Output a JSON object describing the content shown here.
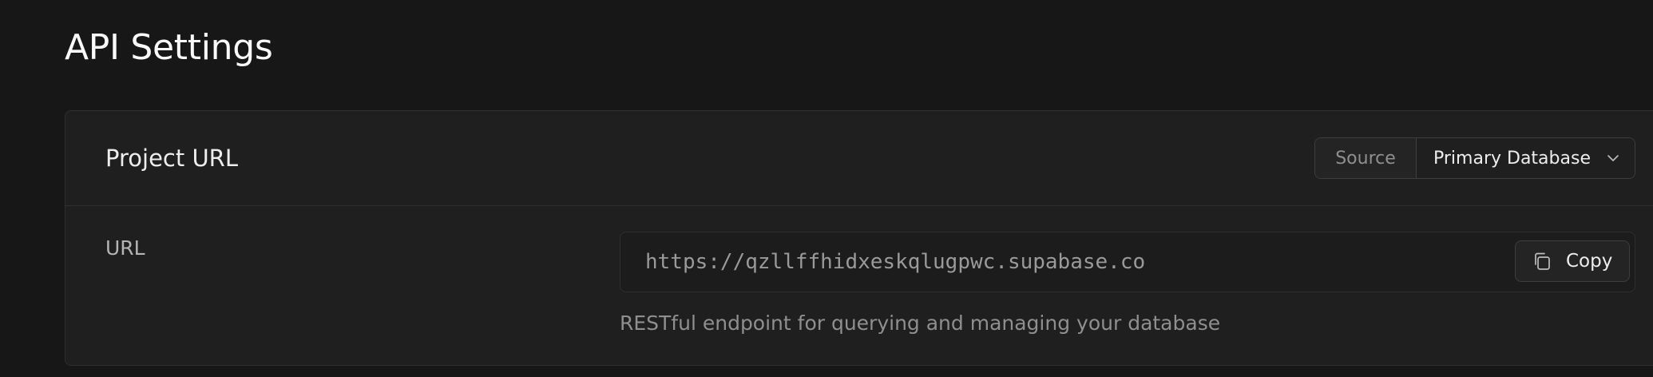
{
  "page": {
    "title": "API Settings"
  },
  "project_url_card": {
    "title": "Project URL",
    "source": {
      "label": "Source",
      "selected": "Primary Database",
      "icon": "chevron-down-icon"
    },
    "url_row": {
      "label": "URL",
      "value": "https://qzllffhidxeskqlugpwc.supabase.co",
      "copy_label": "Copy",
      "copy_icon": "copy-icon",
      "helper": "RESTful endpoint for querying and managing your database"
    }
  },
  "colors": {
    "background": "#171717",
    "card": "#1f1f1f",
    "border": "#2e2e2e",
    "text": "#ededed",
    "muted": "#8f8f8f"
  }
}
